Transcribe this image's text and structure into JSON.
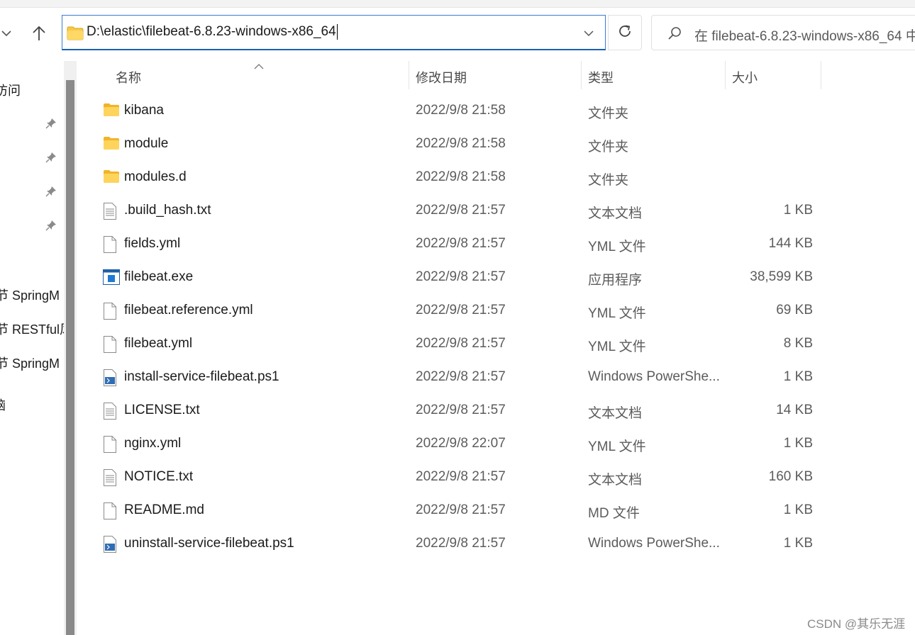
{
  "address": {
    "path": "D:\\elastic\\filebeat-6.8.23-windows-x86_64"
  },
  "search": {
    "placeholder": "在 filebeat-6.8.23-windows-x86_64 中"
  },
  "columns": {
    "name": "名称",
    "modified": "修改日期",
    "type": "类型",
    "size": "大小"
  },
  "sidebar": {
    "items": [
      "访问",
      "节 SpringM",
      "节 RESTful风",
      "节 SpringM",
      "脑"
    ]
  },
  "files": [
    {
      "icon": "folder-icon",
      "name": "kibana",
      "modified": "2022/9/8 21:58",
      "type": "文件夹",
      "size": ""
    },
    {
      "icon": "folder-icon",
      "name": "module",
      "modified": "2022/9/8 21:58",
      "type": "文件夹",
      "size": ""
    },
    {
      "icon": "folder-icon",
      "name": "modules.d",
      "modified": "2022/9/8 21:58",
      "type": "文件夹",
      "size": ""
    },
    {
      "icon": "text-file-icon",
      "name": ".build_hash.txt",
      "modified": "2022/9/8 21:57",
      "type": "文本文档",
      "size": "1 KB"
    },
    {
      "icon": "blank-file-icon",
      "name": "fields.yml",
      "modified": "2022/9/8 21:57",
      "type": "YML 文件",
      "size": "144 KB"
    },
    {
      "icon": "exe-file-icon",
      "name": "filebeat.exe",
      "modified": "2022/9/8 21:57",
      "type": "应用程序",
      "size": "38,599 KB"
    },
    {
      "icon": "blank-file-icon",
      "name": "filebeat.reference.yml",
      "modified": "2022/9/8 21:57",
      "type": "YML 文件",
      "size": "69 KB"
    },
    {
      "icon": "blank-file-icon",
      "name": "filebeat.yml",
      "modified": "2022/9/8 21:57",
      "type": "YML 文件",
      "size": "8 KB"
    },
    {
      "icon": "powershell-file-icon",
      "name": "install-service-filebeat.ps1",
      "modified": "2022/9/8 21:57",
      "type": "Windows PowerShe...",
      "size": "1 KB"
    },
    {
      "icon": "text-file-icon",
      "name": "LICENSE.txt",
      "modified": "2022/9/8 21:57",
      "type": "文本文档",
      "size": "14 KB"
    },
    {
      "icon": "blank-file-icon",
      "name": "nginx.yml",
      "modified": "2022/9/8 22:07",
      "type": "YML 文件",
      "size": "1 KB"
    },
    {
      "icon": "text-file-icon",
      "name": "NOTICE.txt",
      "modified": "2022/9/8 21:57",
      "type": "文本文档",
      "size": "160 KB"
    },
    {
      "icon": "blank-file-icon",
      "name": "README.md",
      "modified": "2022/9/8 21:57",
      "type": "MD 文件",
      "size": "1 KB"
    },
    {
      "icon": "powershell-file-icon",
      "name": "uninstall-service-filebeat.ps1",
      "modified": "2022/9/8 21:57",
      "type": "Windows PowerShe...",
      "size": "1 KB"
    }
  ],
  "watermark": "CSDN @其乐无涯"
}
